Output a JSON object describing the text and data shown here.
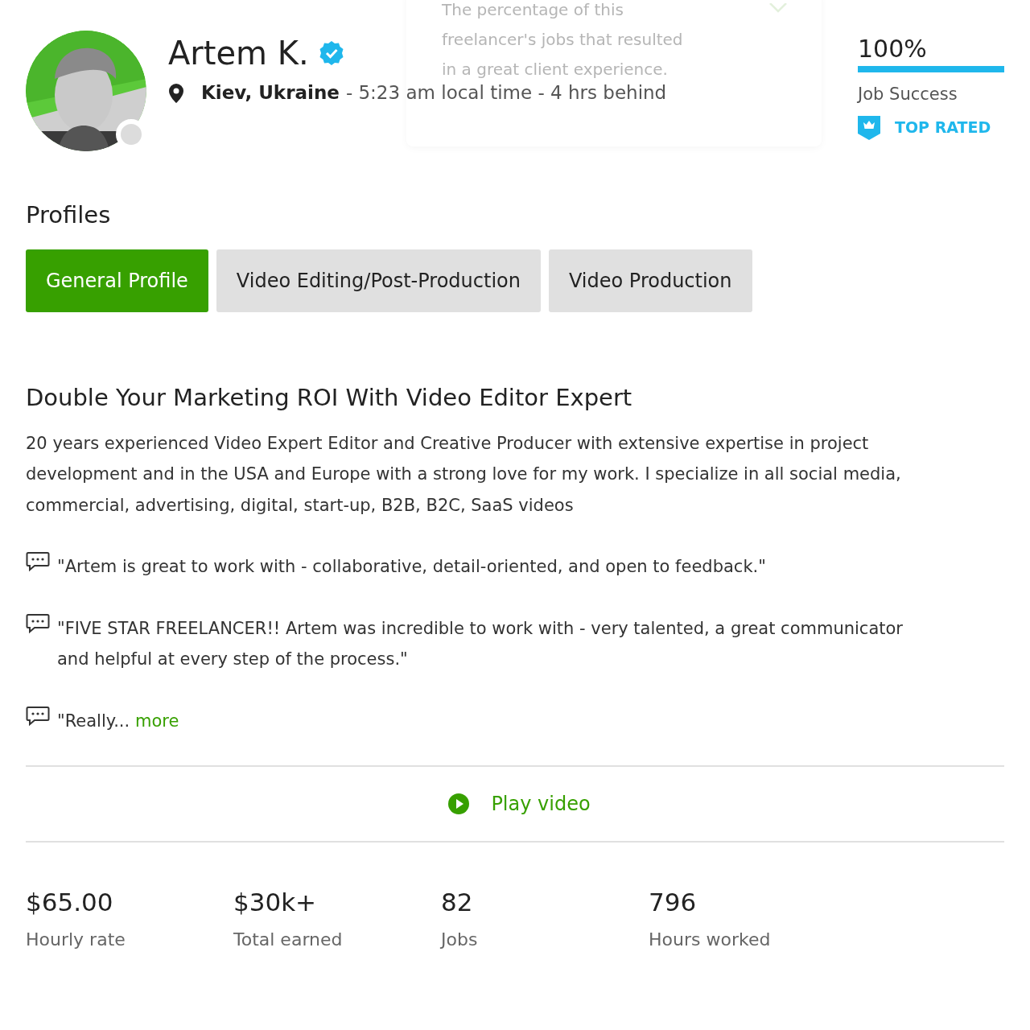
{
  "tooltip": {
    "lines": [
      "The percentage of this",
      "freelancer's jobs that resulted",
      "in a great client experience."
    ]
  },
  "profile": {
    "name": "Artem K.",
    "verified": true,
    "online": false,
    "location": "Kiev, Ukraine",
    "local_time": "- 5:23 am local time - 4 hrs behind"
  },
  "job_success": {
    "value": "100%",
    "level": 1,
    "label": "Job Success",
    "badge": "TOP RATED"
  },
  "profiles_heading": "Profiles",
  "tabs": [
    {
      "label": "General Profile",
      "selected": true
    },
    {
      "label": "Video Editing/Post-Production",
      "selected": false
    },
    {
      "label": "Video Production",
      "selected": false
    }
  ],
  "title": "Double Your Marketing ROI With Video Editor Expert",
  "description": "20 years experienced Video Expert Editor and Creative Producer with extensive expertise in project development and in the USA and Europe with a strong love for my work. I specialize in all social media, commercial, advertising, digital, start-up, B2B, B2C, SaaS videos",
  "quotes": [
    {
      "text": "\"Artem is great to work with - collaborative, detail-oriented, and open to feedback.\""
    },
    {
      "text": "\"FIVE STAR FREELANCER!! Artem was incredible to work with - very talented, a great communicator and helpful at every step of the process.\""
    },
    {
      "text": "\"Really...",
      "link": "more"
    }
  ],
  "play_video": "Play video",
  "stats": [
    {
      "value": "$65.00",
      "label": "Hourly rate"
    },
    {
      "value": "$30k+",
      "label": "Total earned"
    },
    {
      "value": "82",
      "label": "Jobs"
    },
    {
      "value": "796",
      "label": "Hours worked"
    }
  ]
}
